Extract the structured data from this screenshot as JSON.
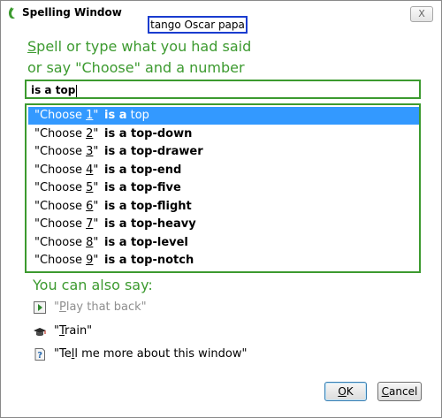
{
  "window": {
    "title": "Spelling Window",
    "close_label": "X"
  },
  "heard": "tango Oscar papa",
  "prompt": {
    "line1_first": "S",
    "line1_rest": "pell or type what you had said",
    "line2": "or say \"Choose\" and a number"
  },
  "input": {
    "value": "is a top"
  },
  "choices": [
    {
      "prefix": "\"Choose ",
      "num": "1",
      "suffix": "\"",
      "bold": "is a",
      "rest": " top"
    },
    {
      "prefix": "\"Choose ",
      "num": "2",
      "suffix": "\"",
      "bold": "is a",
      "rest": " top-down"
    },
    {
      "prefix": "\"Choose ",
      "num": "3",
      "suffix": "\"",
      "bold": "is a",
      "rest": " top-drawer"
    },
    {
      "prefix": "\"Choose ",
      "num": "4",
      "suffix": "\"",
      "bold": "is a",
      "rest": " top-end"
    },
    {
      "prefix": "\"Choose ",
      "num": "5",
      "suffix": "\"",
      "bold": "is a",
      "rest": " top-five"
    },
    {
      "prefix": "\"Choose ",
      "num": "6",
      "suffix": "\"",
      "bold": "is a",
      "rest": " top-flight"
    },
    {
      "prefix": "\"Choose ",
      "num": "7",
      "suffix": "\"",
      "bold": "is a",
      "rest": " top-heavy"
    },
    {
      "prefix": "\"Choose ",
      "num": "8",
      "suffix": "\"",
      "bold": "is a",
      "rest": " top-level"
    },
    {
      "prefix": "\"Choose ",
      "num": "9",
      "suffix": "\"",
      "bold": "is a",
      "rest": " top-notch"
    }
  ],
  "also_say": "You can also say:",
  "commands": {
    "play": {
      "open": "\"",
      "u": "P",
      "rest": "lay that back\"",
      "icon": "play-icon"
    },
    "train": {
      "open": "\"",
      "u": "T",
      "rest": "rain\"",
      "icon": "graduation-cap-icon"
    },
    "tell": {
      "open": "\"Te",
      "u": "l",
      "rest": "l me more about this window\"",
      "icon": "help-icon"
    }
  },
  "buttons": {
    "ok": {
      "u": "O",
      "rest": "K"
    },
    "cancel": {
      "u": "C",
      "rest": "ancel"
    }
  },
  "colors": {
    "accent_green": "#3c9a2f",
    "selection_blue": "#3399ff",
    "heard_border": "#1a3ccf"
  }
}
